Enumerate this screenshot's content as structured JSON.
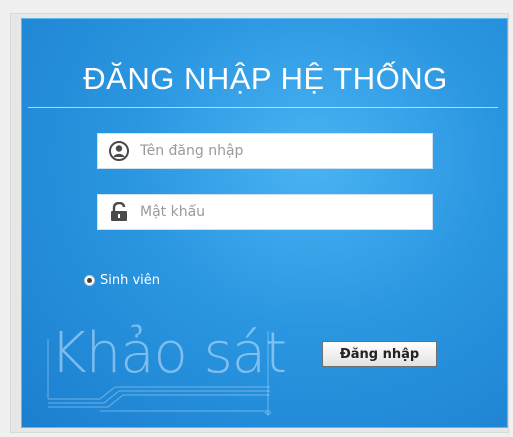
{
  "login": {
    "title": "ĐĂNG NHẬP HỆ THỐNG",
    "username_placeholder": "Tên đăng nhập",
    "username_value": "",
    "password_placeholder": "Mật khẩu",
    "password_value": "",
    "role_option": "Sinh viên",
    "submit_label": "Đăng nhập"
  },
  "logo": {
    "text": "Khảo sát"
  },
  "icons": {
    "username": "user-icon",
    "password": "lock-icon"
  },
  "colors": {
    "panel_blue": "#2a96e0",
    "panel_blue_light": "#49b3f3",
    "text_white": "#ffffff"
  }
}
